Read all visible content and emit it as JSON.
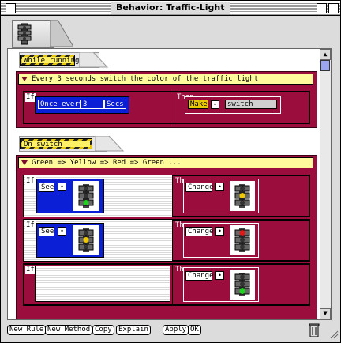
{
  "window": {
    "title": "Behavior: Traffic-Light"
  },
  "sections": [
    {
      "label": "While running",
      "blocks": [
        {
          "comment": "Every 3 seconds switch the color of the traffic light",
          "rules": [
            {
              "if_label": "If",
              "then_label": "Then",
              "condition": {
                "text": "Once every",
                "value": "3",
                "unit": "Secs"
              },
              "action": {
                "verb": "Make",
                "target": "switch"
              }
            }
          ]
        }
      ]
    },
    {
      "label": "On switch",
      "blocks": [
        {
          "comment": "Green => Yellow => Red => Green ...",
          "rules": [
            {
              "if_label": "If",
              "then_label": "Then",
              "condition": {
                "verb": "See",
                "light": "green"
              },
              "action": {
                "verb": "Change",
                "light": "yellow"
              }
            },
            {
              "if_label": "If",
              "then_label": "Then",
              "condition": {
                "verb": "See",
                "light": "yellow"
              },
              "action": {
                "verb": "Change",
                "light": "red"
              }
            },
            {
              "if_label": "If",
              "then_label": "Then",
              "condition": null,
              "action": {
                "verb": "Change",
                "light": "green"
              }
            }
          ]
        }
      ]
    }
  ],
  "buttons": {
    "new_rule": "New Rule",
    "new_method": "New Method",
    "copy": "Copy",
    "explain": "Explain",
    "apply": "Apply",
    "ok": "OK"
  },
  "icons": {
    "header": "traffic-light-icon",
    "trash": "trash-icon"
  },
  "colors": {
    "block": "#9a0d3c",
    "condition": "#0a1fd6",
    "comment": "#fffb9c",
    "label_stripe": "#e8c800"
  }
}
